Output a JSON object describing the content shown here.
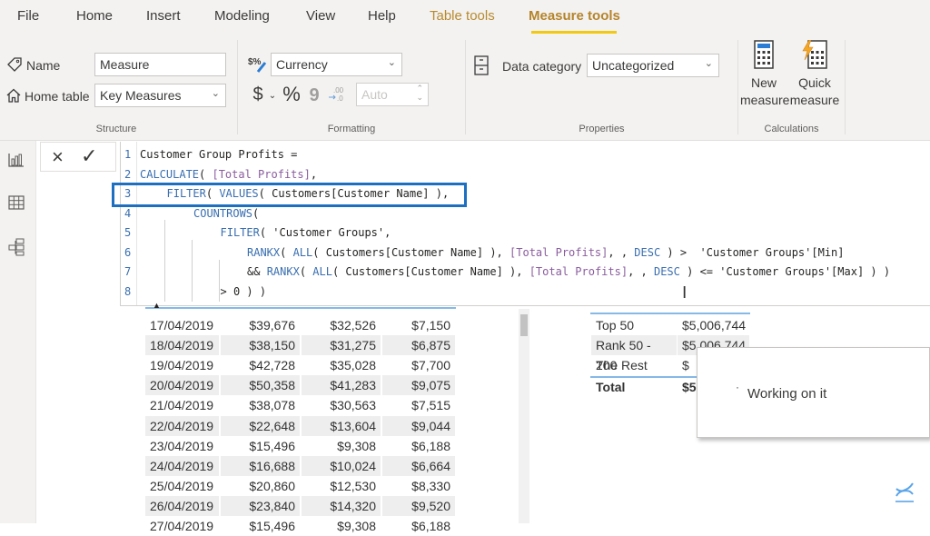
{
  "tabs": [
    {
      "label": "File",
      "state": "normal"
    },
    {
      "label": "Home",
      "state": "normal"
    },
    {
      "label": "Insert",
      "state": "normal"
    },
    {
      "label": "Modeling",
      "state": "normal"
    },
    {
      "label": "View",
      "state": "normal"
    },
    {
      "label": "Help",
      "state": "normal"
    },
    {
      "label": "Table tools",
      "state": "contextual"
    },
    {
      "label": "Measure tools",
      "state": "active"
    }
  ],
  "ribbon": {
    "structure": {
      "group_label": "Structure",
      "name_label": "Name",
      "name_value": "Measure",
      "home_table_label": "Home table",
      "home_table_value": "Key Measures"
    },
    "formatting": {
      "group_label": "Formatting",
      "format_value": "Currency",
      "currency_symbol": "$",
      "percent_symbol": "%",
      "comma_symbol": "9",
      "decimal_places_value": "Auto"
    },
    "properties": {
      "group_label": "Properties",
      "data_category_label": "Data category",
      "data_category_value": "Uncategorized"
    },
    "calculations": {
      "group_label": "Calculations",
      "new_measure_line1": "New",
      "new_measure_line2": "measure",
      "quick_measure_line1": "Quick",
      "quick_measure_line2": "measure"
    }
  },
  "formula_bar": {
    "cancel_icon": "×",
    "commit_icon": "✓",
    "highlighted_line": 3,
    "lines": [
      {
        "n": "1",
        "indent": 0,
        "parts": [
          [
            "t",
            "Customer Group Profits ="
          ]
        ]
      },
      {
        "n": "2",
        "indent": 0,
        "parts": [
          [
            "k",
            "CALCULATE"
          ],
          [
            "t",
            "( "
          ],
          [
            "m",
            "[Total Profits]"
          ],
          [
            "t",
            ","
          ]
        ]
      },
      {
        "n": "3",
        "indent": 1,
        "parts": [
          [
            "k",
            "FILTER"
          ],
          [
            "t",
            "( "
          ],
          [
            "k",
            "VALUES"
          ],
          [
            "t",
            "( Customers[Customer Name] ),"
          ]
        ]
      },
      {
        "n": "4",
        "indent": 2,
        "parts": [
          [
            "k",
            "COUNTROWS"
          ],
          [
            "t",
            "("
          ]
        ]
      },
      {
        "n": "5",
        "indent": 3,
        "parts": [
          [
            "k",
            "FILTER"
          ],
          [
            "t",
            "( 'Customer Groups',"
          ]
        ]
      },
      {
        "n": "6",
        "indent": 4,
        "parts": [
          [
            "k",
            "RANKX"
          ],
          [
            "t",
            "( "
          ],
          [
            "k",
            "ALL"
          ],
          [
            "t",
            "( Customers[Customer Name] ), "
          ],
          [
            "m",
            "[Total Profits]"
          ],
          [
            "t",
            ", , "
          ],
          [
            "k",
            "DESC"
          ],
          [
            "t",
            " ) >  'Customer Groups'[Min]"
          ]
        ]
      },
      {
        "n": "7",
        "indent": 4,
        "parts": [
          [
            "t",
            "&& "
          ],
          [
            "k",
            "RANKX"
          ],
          [
            "t",
            "( "
          ],
          [
            "k",
            "ALL"
          ],
          [
            "t",
            "( Customers[Customer Name] ), "
          ],
          [
            "m",
            "[Total Profits]"
          ],
          [
            "t",
            ", , "
          ],
          [
            "k",
            "DESC"
          ],
          [
            "t",
            " ) <= 'Customer Groups'[Max] ) )"
          ]
        ]
      },
      {
        "n": "8",
        "indent": 3,
        "parts": [
          [
            "t",
            "> 0 ) )"
          ]
        ]
      }
    ]
  },
  "sales_table": {
    "sort_indicator": "▲",
    "rows": [
      [
        "17/04/2019",
        "$39,676",
        "$32,526",
        "$7,150"
      ],
      [
        "18/04/2019",
        "$38,150",
        "$31,275",
        "$6,875"
      ],
      [
        "19/04/2019",
        "$42,728",
        "$35,028",
        "$7,700"
      ],
      [
        "20/04/2019",
        "$50,358",
        "$41,283",
        "$9,075"
      ],
      [
        "21/04/2019",
        "$38,078",
        "$30,563",
        "$7,515"
      ],
      [
        "22/04/2019",
        "$22,648",
        "$13,604",
        "$9,044"
      ],
      [
        "23/04/2019",
        "$15,496",
        "$9,308",
        "$6,188"
      ],
      [
        "24/04/2019",
        "$16,688",
        "$10,024",
        "$6,664"
      ],
      [
        "25/04/2019",
        "$20,860",
        "$12,530",
        "$8,330"
      ],
      [
        "26/04/2019",
        "$23,840",
        "$14,320",
        "$9,520"
      ],
      [
        "27/04/2019",
        "$15,496",
        "$9,308",
        "$6,188"
      ]
    ]
  },
  "groups_table": {
    "rows": [
      [
        "Top 50",
        "$5,006,744"
      ],
      [
        "Rank 50 - 200",
        "$5,006,744"
      ],
      [
        "The Rest",
        "$"
      ]
    ],
    "total": [
      "Total",
      "$5"
    ]
  },
  "working_popup": {
    "text": "Working on it"
  },
  "colors": {
    "accent_yellow": "#f2c811",
    "contextual_tab": "#b88a2d",
    "highlight_box": "#1d6fc0",
    "keyword": "#3a6fb0",
    "measure_ref": "#8a5c9e"
  }
}
